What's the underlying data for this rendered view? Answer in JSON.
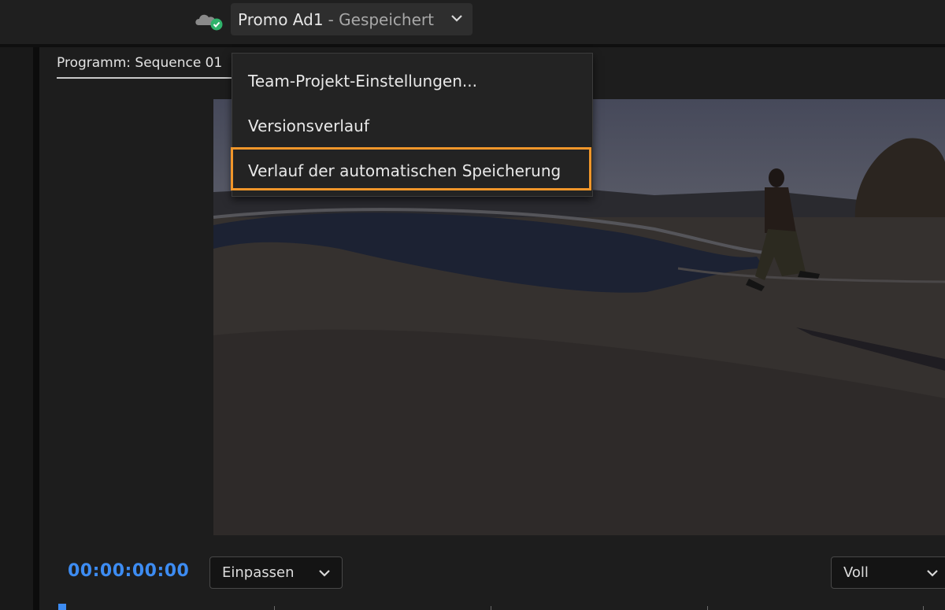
{
  "header": {
    "project_name": "Promo Ad1",
    "save_status": "- Gespeichert",
    "icons": {
      "cloud": "cloud-sync-icon",
      "check": "check-badge-icon",
      "dropdown": "chevron-down-icon"
    }
  },
  "panel": {
    "tab_label": "Programm: Sequence 01"
  },
  "menu": {
    "items": [
      {
        "label": "Team-Projekt-Einstellungen..."
      },
      {
        "label": "Versionsverlauf"
      },
      {
        "label": "Verlauf der automatischen Speicherung",
        "highlighted": true
      }
    ]
  },
  "controls": {
    "timecode": "00:00:00:00",
    "zoom_select": "Einpassen",
    "resolution_select": "Voll"
  },
  "colors": {
    "accent_blue": "#3d8cf2",
    "highlight_orange": "#f0962a",
    "check_green": "#2fb36b"
  }
}
